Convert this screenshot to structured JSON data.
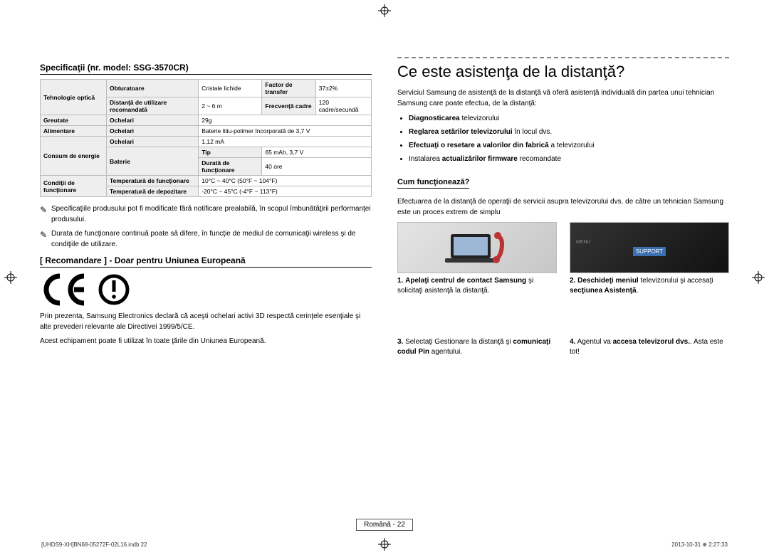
{
  "left": {
    "spec_title": "Specificaţii (nr. model: SSG-3570CR)",
    "table": {
      "tech": "Tehnologie optică",
      "shutter": "Obturatoare",
      "shutter_v": "Cristale lichide",
      "transfer": "Factor de transfer",
      "transfer_v": "37±2%",
      "dist": "Distanţă de utilizare recomandată",
      "dist_v": "2 ~ 6 m",
      "freq": "Frecvenţă cadre",
      "freq_v": "120 cadre/secundă",
      "weight": "Greutate",
      "glasses": "Ochelari",
      "weight_v": "29g",
      "power": "Alimentare",
      "power_v": "Baterie litiu-polimer încorporată de 3,7 V",
      "consumption": "Consum de energie",
      "cons_glasses_v": "1,12 mA",
      "battery": "Baterie",
      "tip": "Tip",
      "tip_v": "65 mAh, 3,7 V",
      "runtime": "Durată de funcţionare",
      "runtime_v": "40 ore",
      "cond": "Condiţii de funcţionare",
      "temp_op": "Temperatură de funcţionare",
      "temp_op_v": "10°C ~ 40°C (50°F ~ 104°F)",
      "temp_st": "Temperatură de depozitare",
      "temp_st_v": "-20°C ~ 45°C (-4°F ~ 113°F)"
    },
    "note1": "Specificaţiile produsului pot fi modificate fără notificare prealabilă, în scopul îmbunătăţirii performanţei produsului.",
    "note2": "Durata de funcţionare continuă poate să difere, în funcţie de mediul de comunicaţii wireless şi de condiţiile de utilizare.",
    "eu_title": "[ Recomandare ] - Doar pentru Uniunea Europeană",
    "eu_p1": "Prin prezenta, Samsung Electronics declară că aceşti ochelari activi 3D respectă cerinţele esenţiale şi alte prevederi relevante ale Directivei 1999/5/CE.",
    "eu_p2": "Acest echipament poate fi utilizat în toate ţările din Uniunea Europeană."
  },
  "right": {
    "title": "Ce este asistenţa de la distanţă?",
    "intro": "Serviciul Samsung de asistenţă de la distanţă vă oferă asistenţă individuală din partea unui tehnician Samsung care poate efectua, de la distanţă:",
    "b1a": "Diagnosticarea",
    "b1b": " televizorului",
    "b2a": "Reglarea setărilor televizorului",
    "b2b": " în locul dvs.",
    "b3a": "Efectuaţi o resetare a valorilor din fabrică",
    "b3b": " a televizorului",
    "b4a": "Instalarea ",
    "b4b": "actualizărilor firmware",
    "b4c": " recomandate",
    "how_title": "Cum funcţionează?",
    "how_intro": "Efectuarea de la distanţă de operaţii de servicii asupra televizorului dvs. de către un tehnician Samsung este un proces extrem de simplu",
    "s1n": "1.",
    "s1a": "Apelaţi centrul de contact Samsung",
    "s1b": " şi solicitaţi asistenţă la distanţă.",
    "s2n": "2.",
    "s2a": "Deschideţi meniul",
    "s2b": " televizorului şi accesaţi ",
    "s2c": "secţiunea Asistenţă",
    "s2d": ".",
    "s3n": "3.",
    "s3a": "Selectaţi Gestionare la distanţă şi ",
    "s3b": "comunicaţi codul Pin",
    "s3c": " agentului.",
    "s4n": "4.",
    "s4a": "Agentul va ",
    "s4b": "accesa televizorul dvs.",
    "s4c": ". Asta este tot!",
    "img2_badge": "SUPPORT",
    "img2_menu": "MENU"
  },
  "footer": {
    "lang_page": "Română - 22"
  },
  "docfooter": {
    "left": "[UHDS9-XH]BN68-05272F-02L16.indb   22",
    "right": "2013-10-31   ⊕ 2:27:33"
  }
}
